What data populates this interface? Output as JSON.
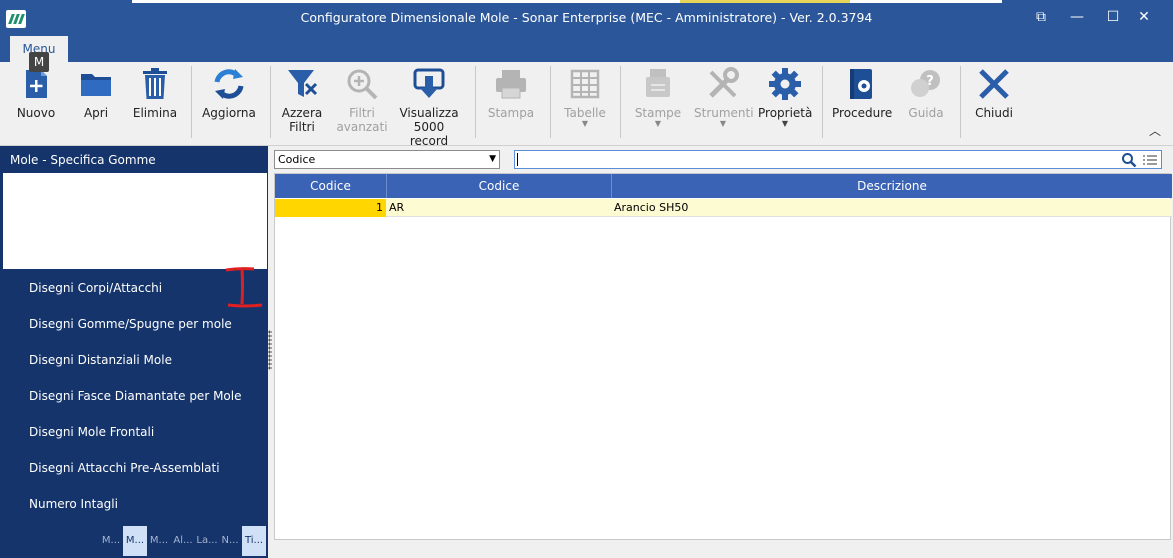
{
  "window": {
    "title": "Configuratore Dimensionale Mole - Sonar Enterprise (MEC - Amministratore) - Ver. 2.0.3794",
    "restore_glyph": "⧉",
    "minimize_glyph": "—",
    "maximize_glyph": "☐",
    "close_glyph": "✕"
  },
  "ribbon_tab": {
    "label": "Menu",
    "keytip": "M"
  },
  "toolbar": {
    "nuovo": "Nuovo",
    "apri": "Apri",
    "elimina": "Elimina",
    "aggiorna": "Aggiorna",
    "azzera_filtri_1": "Azzera",
    "azzera_filtri_2": "Filtri",
    "filtri_avanzati_1": "Filtri",
    "filtri_avanzati_2": "avanzati",
    "visualizza_1": "Visualizza",
    "visualizza_2": "5000 record",
    "stampa": "Stampa",
    "tabelle": "Tabelle",
    "stampe": "Stampe",
    "strumenti": "Strumenti",
    "proprieta": "Proprietà",
    "procedure": "Procedure",
    "guida": "Guida",
    "chiudi": "Chiudi"
  },
  "left_panel": {
    "header": "Mole - Specifica Gomme",
    "items": [
      "Disegni Corpi/Attacchi",
      "Disegni Gomme/Spugne per mole",
      "Disegni Distanziali Mole",
      "Disegni Fasce Diamantate per Mole",
      "Disegni Mole Frontali",
      "Disegni Attacchi Pre-Assemblati",
      "Numero Intagli"
    ],
    "tabs": [
      "M...",
      "M...",
      "M...",
      "Al...",
      "La...",
      "N...",
      "Ti..."
    ]
  },
  "filter": {
    "field": "Codice",
    "search_value": ""
  },
  "grid": {
    "columns": [
      "Codice",
      "Codice",
      "Descrizione"
    ],
    "rows": [
      {
        "id": "1",
        "code": "AR",
        "description": "Arancio SH50"
      }
    ]
  },
  "colors": {
    "titlebar": "#2b579a",
    "left_panel": "#14346b",
    "grid_header": "#3a62b5",
    "selected_row": "#fdfbd2",
    "selected_cell": "#ffd600",
    "annotation": "#e02020"
  }
}
